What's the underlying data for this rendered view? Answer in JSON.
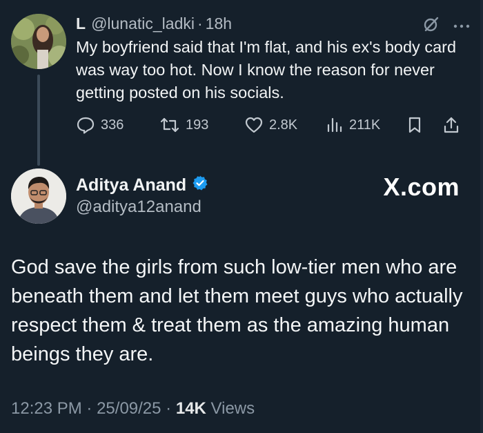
{
  "parent_tweet": {
    "name": "L",
    "handle": "@lunatic_ladki",
    "dot": "·",
    "time": "18h",
    "text": "My boyfriend said that I'm flat, and his ex's body card was way too hot. Now I know the reason for never getting posted on his socials.",
    "icons": [
      "grok-icon",
      "more-icon"
    ],
    "metrics": {
      "replies": "336",
      "reposts": "193",
      "likes": "2.8K",
      "views": "211K"
    }
  },
  "main_tweet": {
    "name": "Aditya Anand",
    "handle": "@aditya12anand",
    "brand": "X.com",
    "text": "God save the girls from such low-tier men who are beneath them and let them meet guys who actually respect them & treat them as the amazing human beings they are.",
    "time": "12:23 PM",
    "date": "25/09/25",
    "dot": "·",
    "views_count": "14K",
    "views_label": "Views"
  },
  "colors": {
    "background": "#15202b",
    "text": "#e7e9ea",
    "muted": "#8b98a5",
    "verified": "#1d9bf0"
  }
}
